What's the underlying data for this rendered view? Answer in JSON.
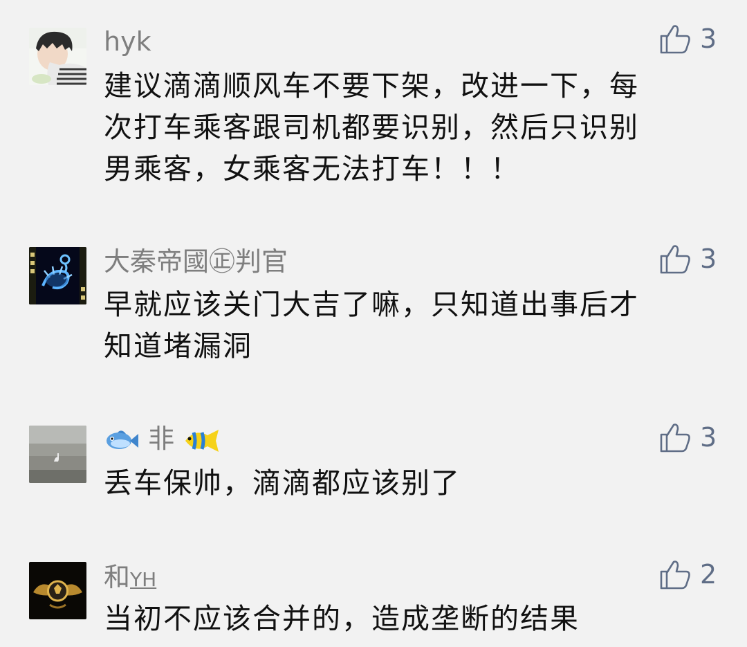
{
  "comments": [
    {
      "username": "hyk",
      "likes": "3",
      "lines": [
        "建议滴滴顺风车不要下架，改进一下，每",
        "次打车乘客跟司机都要识别，然后只识别",
        "男乘客，女乘客无法打车！！！"
      ]
    },
    {
      "username": "大秦帝國㊣判官",
      "likes": "3",
      "lines": [
        "早就应该关门大吉了嘛，只知道出事后才",
        "知道堵漏洞"
      ]
    },
    {
      "username_text": "非",
      "likes": "3",
      "lines": [
        "丢车保帅，滴滴都应该别了"
      ]
    },
    {
      "username_main": "和",
      "username_suffix": "YH",
      "likes": "2",
      "lines": [
        "当初不应该合并的，造成垄断的结果"
      ]
    }
  ],
  "colors": {
    "background": "#f2f2f2",
    "username": "#7e7e7e",
    "like_accent": "#5f6d86",
    "body_text": "#111111"
  },
  "icons": [
    "thumbs-up-icon",
    "fish-emoji-icon",
    "tropical-fish-emoji-icon"
  ]
}
